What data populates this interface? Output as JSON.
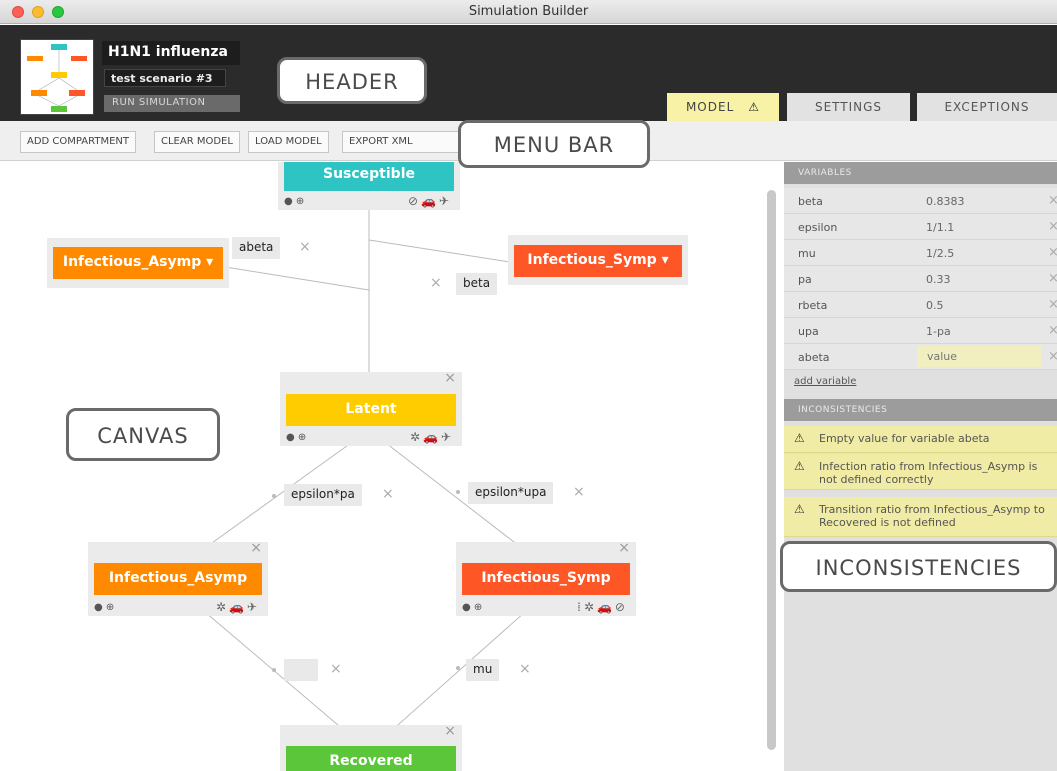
{
  "window": {
    "title": "Simulation Builder"
  },
  "header": {
    "project_name": "H1N1 influenza",
    "scenario": "test scenario #3",
    "run_button": "RUN SIMULATION"
  },
  "tabs": [
    {
      "label": "MODEL",
      "warning_icon": "warning-icon",
      "active": true
    },
    {
      "label": "SETTINGS"
    },
    {
      "label": "EXCEPTIONS"
    }
  ],
  "callouts": {
    "header": "HEADER",
    "menu_bar": "MENU BAR",
    "canvas": "CANVAS",
    "inconsistencies": "INCONSISTENCIES"
  },
  "menu": {
    "add_compartment": "ADD COMPARTMENT",
    "clear_model": "CLEAR MODEL",
    "load_model": "LOAD MODEL",
    "export_xml": "EXPORT XML"
  },
  "compartments": {
    "susceptible": {
      "label": "Susceptible",
      "color": "#2ec4c4"
    },
    "infectious_asymp_top": {
      "label": "Infectious_Asymp",
      "color": "#ff8a00"
    },
    "infectious_symp_top": {
      "label": "Infectious_Symp",
      "color": "#ff5626"
    },
    "latent": {
      "label": "Latent",
      "color": "#ffcc00"
    },
    "infectious_asymp": {
      "label": "Infectious_Asymp",
      "color": "#ff8a00"
    },
    "infectious_symp": {
      "label": "Infectious_Symp",
      "color": "#ff5626"
    },
    "recovered": {
      "label": "Recovered",
      "color": "#5cc63a"
    }
  },
  "transitions": {
    "abeta": "abeta",
    "beta": "beta",
    "epsilon_pa": "epsilon*pa",
    "epsilon_upa": "epsilon*upa",
    "empty": "",
    "mu": "mu"
  },
  "variables": {
    "title": "VARIABLES",
    "items": [
      {
        "name": "beta",
        "value": "0.8383"
      },
      {
        "name": "epsilon",
        "value": "1/1.1"
      },
      {
        "name": "mu",
        "value": "1/2.5"
      },
      {
        "name": "pa",
        "value": "0.33"
      },
      {
        "name": "rbeta",
        "value": "0.5"
      },
      {
        "name": "upa",
        "value": "1-pa"
      },
      {
        "name": "abeta",
        "value": ""
      }
    ],
    "value_placeholder": "value",
    "add_link": "add variable"
  },
  "inconsistencies": {
    "title": "INCONSISTENCIES",
    "items": [
      {
        "line1": "Empty value for variable abeta",
        "line2": ""
      },
      {
        "line1": "Infection ratio from Infectious_Asymp is",
        "line2": "not defined correctly"
      },
      {
        "line1": "Transition ratio from Infectious_Asymp to",
        "line2": "Recovered is not defined"
      }
    ]
  }
}
